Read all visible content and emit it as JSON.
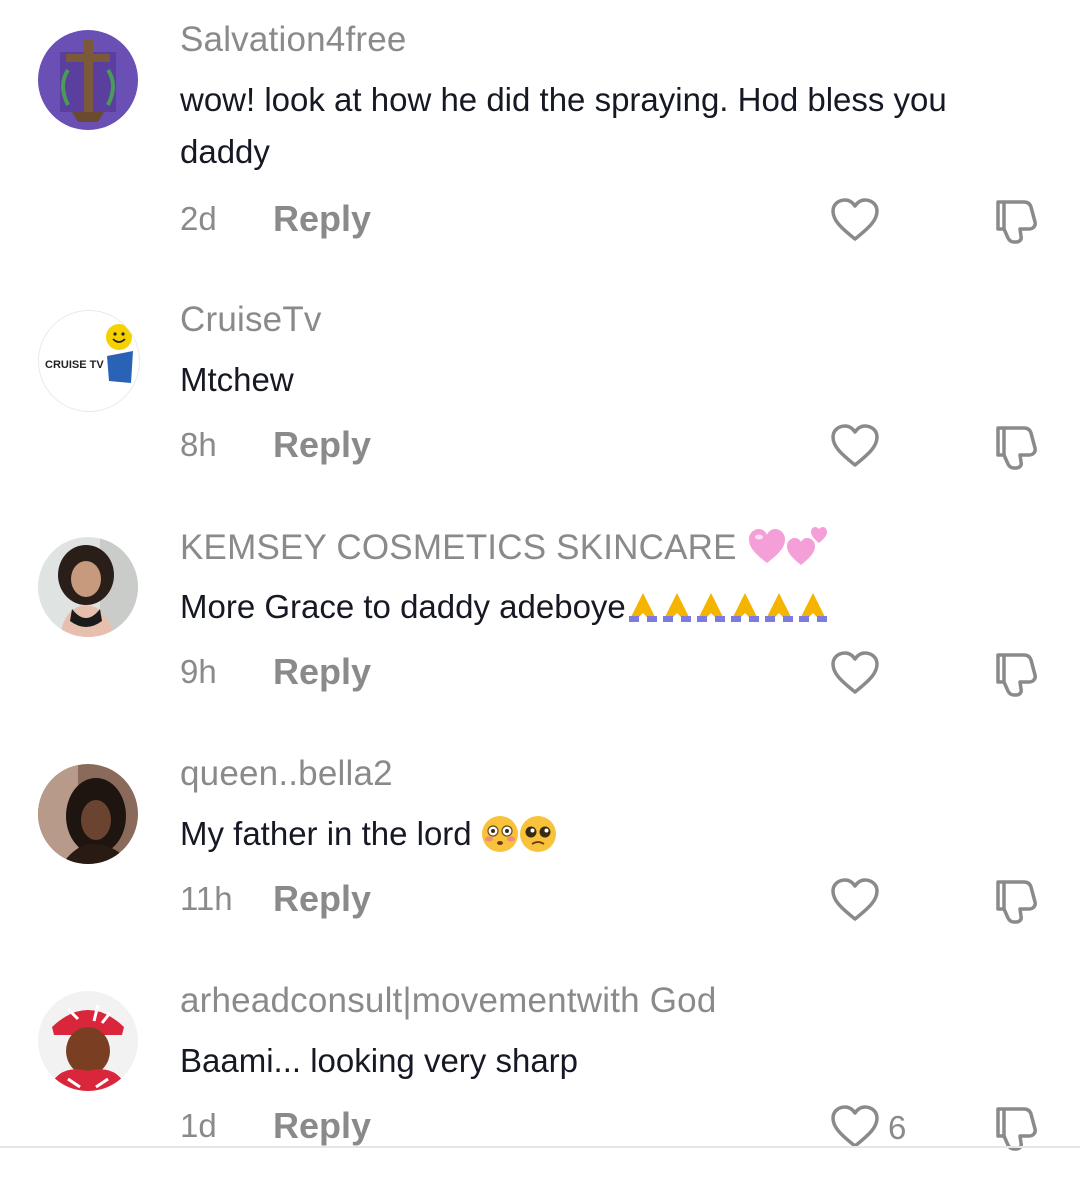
{
  "comments": [
    {
      "username": "Salvation4free",
      "text": "wow! look at how he did the spraying. Hod bless you daddy",
      "time": "2d",
      "reply_label": "Reply",
      "likes": "",
      "avatar": "cross-avatar"
    },
    {
      "username": "CruiseTv",
      "text": "Mtchew",
      "time": "8h",
      "reply_label": "Reply",
      "likes": "",
      "avatar": "cruise-tv-logo",
      "avatar_text": "CRUISE TV"
    },
    {
      "username": "KEMSEY COSMETICS SKINCARE",
      "username_emojis": [
        "heart-emoji",
        "two-hearts-emoji"
      ],
      "text": "More Grace to daddy adeboye",
      "text_emojis": [
        "folded-hands",
        "folded-hands",
        "folded-hands",
        "folded-hands",
        "folded-hands",
        "folded-hands"
      ],
      "time": "9h",
      "reply_label": "Reply",
      "likes": "",
      "avatar": "woman-photo"
    },
    {
      "username": "queen..bella2",
      "text": "My father in the lord",
      "text_emojis": [
        "flushed-face",
        "pleading-face"
      ],
      "time": "11h",
      "reply_label": "Reply",
      "likes": "",
      "avatar": "woman-photo"
    },
    {
      "username": "arheadconsult|movementwith God",
      "text": "Baami... looking very sharp",
      "time": "1d",
      "reply_label": "Reply",
      "likes": "6",
      "avatar": "man-red-cap-photo"
    }
  ],
  "colors": {
    "secondary_text": "#8a8a8a",
    "primary_text": "#161823",
    "icon_stroke": "#8a8a8a"
  }
}
